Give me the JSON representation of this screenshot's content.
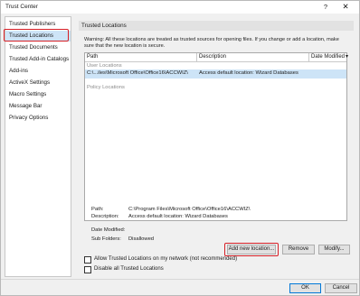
{
  "window": {
    "title": "Trust Center",
    "help_glyph": "?",
    "close_glyph": "✕"
  },
  "nav": {
    "items": [
      {
        "label": "Trusted Publishers"
      },
      {
        "label": "Trusted Locations",
        "selected": true
      },
      {
        "label": "Trusted Documents"
      },
      {
        "label": "Trusted Add-in Catalogs"
      },
      {
        "label": "Add-ins"
      },
      {
        "label": "ActiveX Settings"
      },
      {
        "label": "Macro Settings"
      },
      {
        "label": "Message Bar"
      },
      {
        "label": "Privacy Options"
      }
    ]
  },
  "panel": {
    "header": "Trusted Locations",
    "warning": "Warning: All these locations are treated as trusted sources for opening files.  If you change or add a location, make sure that the new location is secure.",
    "columns": {
      "path": "Path",
      "description": "Description",
      "date_modified": "Date Modified",
      "sort_glyph": "▾"
    },
    "groups": {
      "user": "User Locations",
      "policy": "Policy Locations"
    },
    "rows": [
      {
        "path": "C:\\...iles\\Microsoft Office\\Office16\\ACCWIZ\\",
        "description": "Access default location: Wizard Databases",
        "date_modified": ""
      }
    ]
  },
  "details": {
    "path_label": "Path:",
    "path_value": "C:\\Program Files\\Microsoft Office\\Office16\\ACCWIZ\\",
    "description_label": "Description:",
    "description_value": "Access default location: Wizard Databases",
    "date_label": "Date Modified:",
    "date_value": "",
    "subfolders_label": "Sub Folders:",
    "subfolders_value": "Disallowed"
  },
  "buttons": {
    "add_new": "Add new location...",
    "remove": "Remove",
    "modify": "Modify...",
    "ok": "OK",
    "cancel": "Cancel"
  },
  "options": {
    "allow_network": {
      "label": "Allow Trusted Locations on my network (not recommended)",
      "checked": false
    },
    "disable_all": {
      "label": "Disable all Trusted Locations",
      "checked": false
    }
  },
  "colors": {
    "selection": "#cde4f7",
    "highlight_border": "#d61f26",
    "default_button_border": "#0078d7"
  }
}
